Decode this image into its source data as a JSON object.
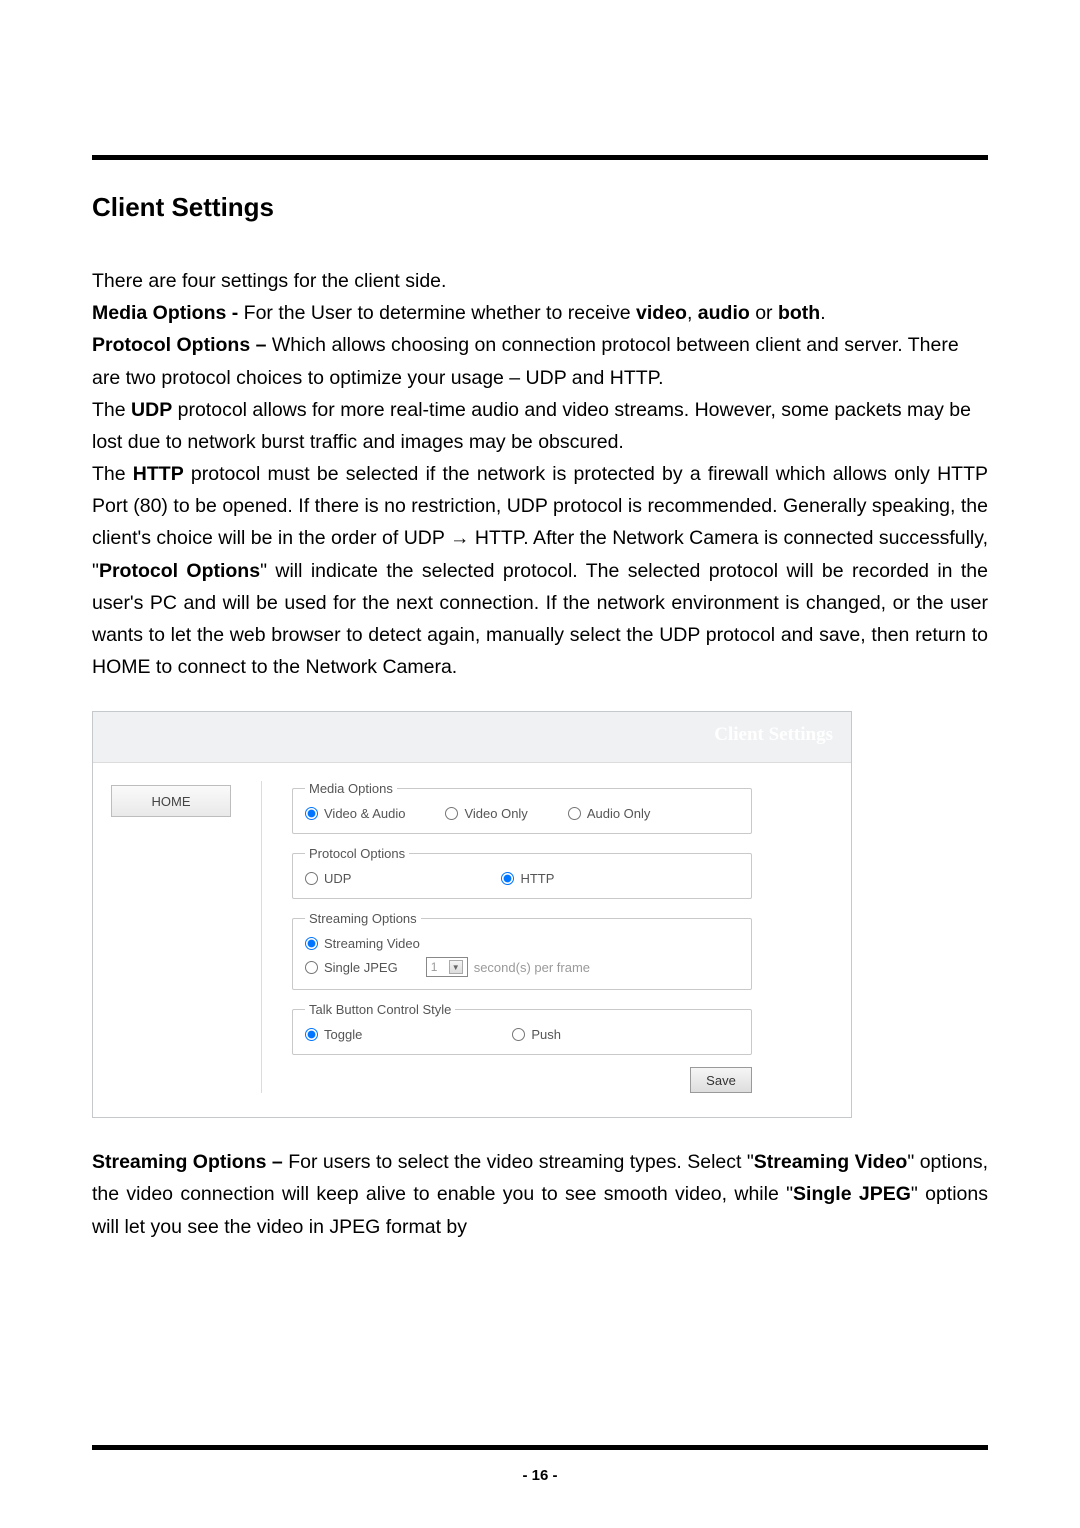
{
  "heading": "Client Settings",
  "intro": "There are four settings for the client side.",
  "mediaLine": {
    "label": "Media Options - ",
    "rest": "For the User to determine whether to receive ",
    "video": "video",
    "sep1": ", ",
    "audio": "audio",
    "sep2": " or ",
    "both": "both",
    "end": "."
  },
  "protoLine": {
    "label": "Protocol Options – ",
    "rest": "Which allows choosing on connection protocol between client and server. There are two protocol choices to optimize your usage – UDP and HTTP."
  },
  "udpLine": {
    "pre": "The ",
    "bold": "UDP",
    "rest": " protocol allows for more real-time audio and video streams. However, some packets may be lost due to network burst traffic and images may be obscured."
  },
  "httpPara": {
    "pre": "The ",
    "bold1": "HTTP",
    "mid1": " protocol must be selected if the network is protected by a firewall which allows only HTTP Port (80) to be opened. If there is no restriction, UDP protocol is recommended. Generally speaking, the client's choice will be in the order of UDP → HTTP. After the Network Camera is connected successfully, \"",
    "bold2": "Protocol Options",
    "mid2": "\" will indicate the selected protocol. The selected protocol will be recorded in the user's PC and will be used for the next connection. If the network environment is changed, or the user wants to let the web browser to detect again, manually select the UDP protocol and save, then return to HOME to connect to the Network Camera."
  },
  "panel": {
    "title": "Client Settings",
    "sidebar": {
      "home": "HOME"
    },
    "groups": {
      "media": {
        "legend": "Media Options",
        "opts": [
          "Video & Audio",
          "Video Only",
          "Audio Only"
        ],
        "selected": 0
      },
      "protocol": {
        "legend": "Protocol Options",
        "opts": [
          "UDP",
          "HTTP"
        ],
        "selected": 1
      },
      "streaming": {
        "legend": "Streaming Options",
        "opt1": "Streaming Video",
        "opt2": "Single JPEG",
        "selectValue": "1",
        "unit": "second(s) per frame",
        "selected": 0
      },
      "talk": {
        "legend": "Talk Button Control Style",
        "opts": [
          "Toggle",
          "Push"
        ],
        "selected": 0
      }
    },
    "save": "Save"
  },
  "streamPara": {
    "label": "Streaming Options – ",
    "t1": "For users to select the video streaming types. Select \"",
    "b1": "Streaming Video",
    "t2": "\" options, the video connection will keep alive to enable you to see smooth video, while \"",
    "b2": "Single JPEG",
    "t3": "\" options will let you see the video in JPEG format by"
  },
  "pageNumber": "- 16 -"
}
